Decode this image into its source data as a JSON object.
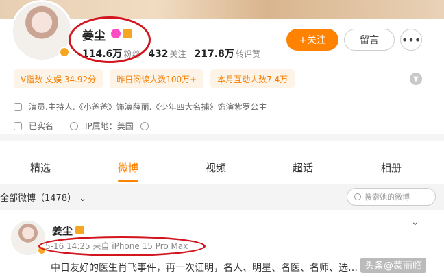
{
  "profile": {
    "name": "姜尘",
    "followers": {
      "value": "114.6万",
      "label": "粉丝"
    },
    "following": {
      "value": "432",
      "label": "关注"
    },
    "reposts": {
      "value": "217.8万",
      "label": "转评赞"
    }
  },
  "buttons": {
    "follow": "+关注",
    "message": "留言",
    "more": "•••"
  },
  "chips": [
    "V指数 文娱 34.92分",
    "昨日阅读人数100万+",
    "本月互动人数7.4万"
  ],
  "info": {
    "bio": "演员.主持人.《小爸爸》饰演薛丽.《少年四大名捕》饰演紫罗公主",
    "verified": "已实名",
    "ip": "IP属地：美国"
  },
  "tabs": [
    "精选",
    "微博",
    "视频",
    "超话",
    "相册"
  ],
  "active_tab": "微博",
  "filter": {
    "label": "全部微博（1478）",
    "search_placeholder": "搜索她的微博"
  },
  "post": {
    "name": "姜尘",
    "meta": "5-16 14:25 来自 iPhone 15 Pro Max",
    "text": "中日友好的医生肖飞事件，再一次证明，名人、明星、名医、名师、选…"
  },
  "watermark": "头条@蒙丽临",
  "colors": {
    "accent": "#ff8200",
    "annotation": "#d2151f",
    "chip_bg": "#fdf3e7"
  }
}
